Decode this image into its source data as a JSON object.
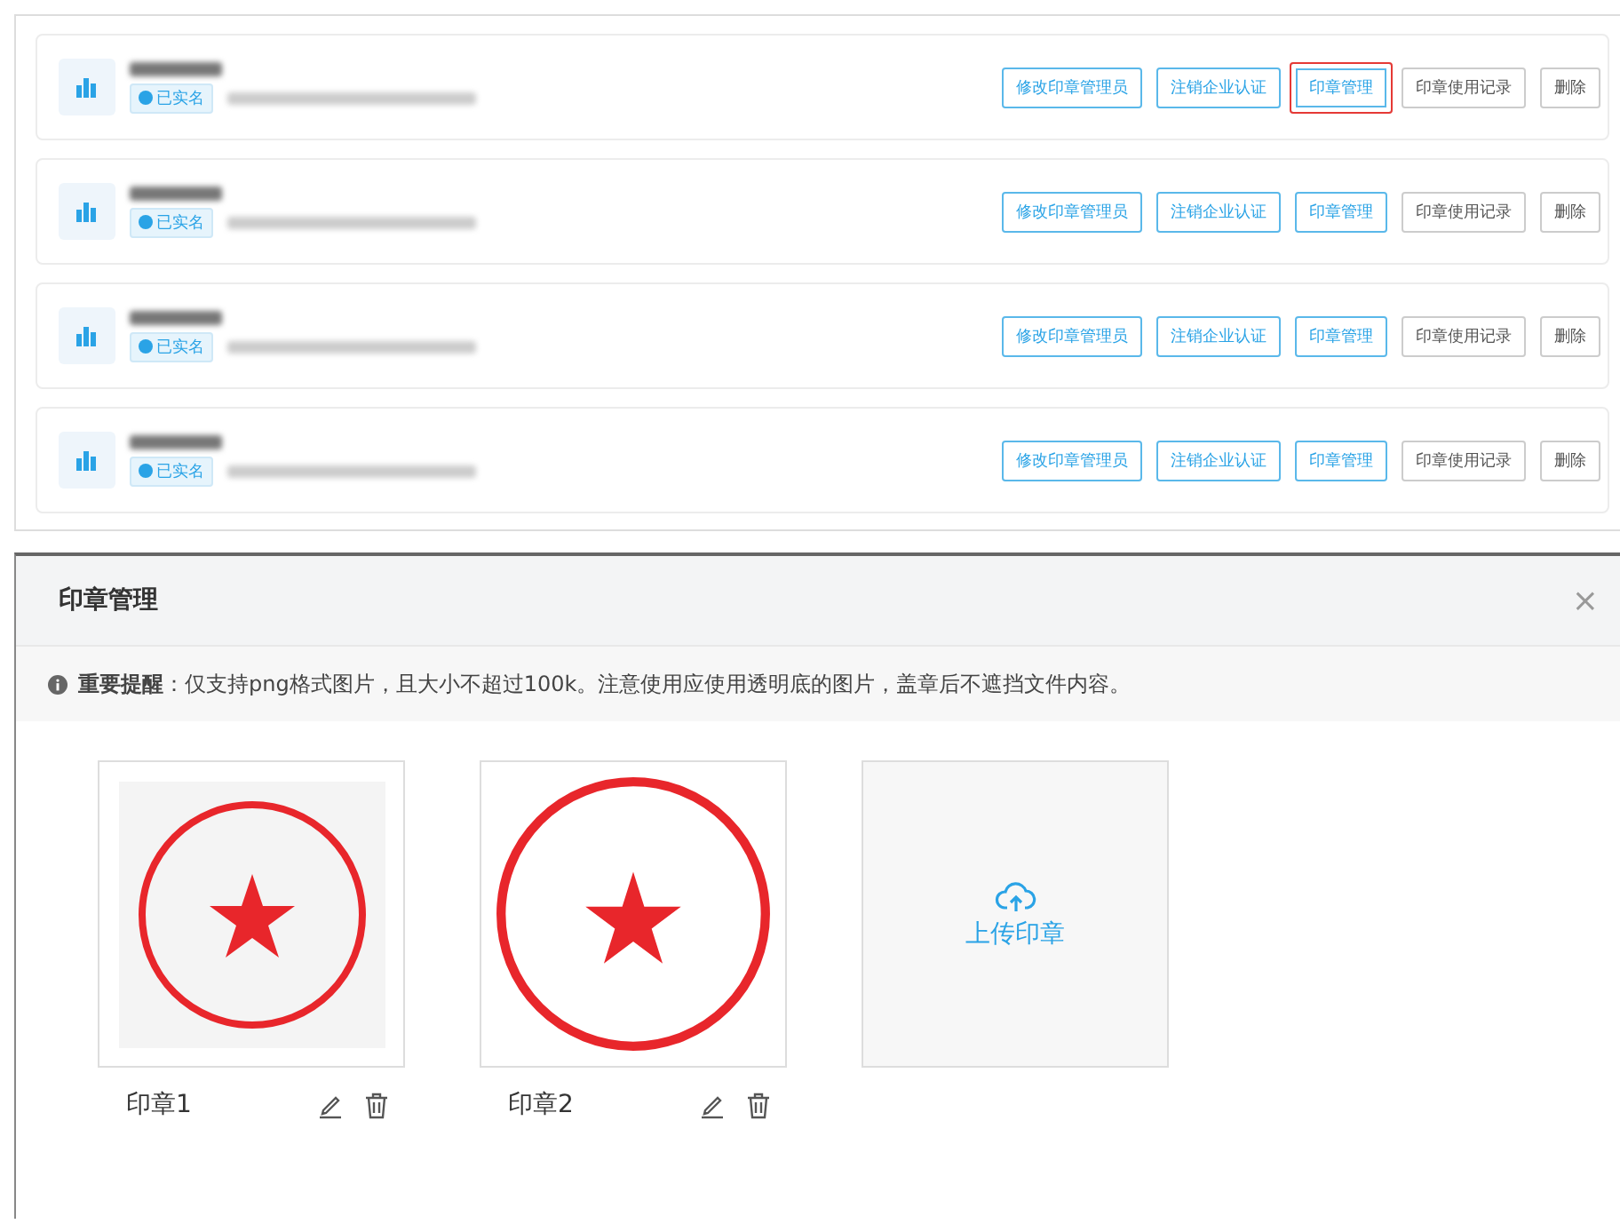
{
  "companies": [
    {
      "verified_badge": "已实名",
      "buttons": [
        {
          "label": "修改印章管理员",
          "kind": "primary",
          "highlighted": false
        },
        {
          "label": "注销企业认证",
          "kind": "primary",
          "highlighted": false
        },
        {
          "label": "印章管理",
          "kind": "primary",
          "highlighted": true
        },
        {
          "label": "印章使用记录",
          "kind": "default",
          "highlighted": false
        },
        {
          "label": "删除",
          "kind": "default",
          "highlighted": false
        }
      ]
    },
    {
      "verified_badge": "已实名",
      "buttons": [
        {
          "label": "修改印章管理员",
          "kind": "primary",
          "highlighted": false
        },
        {
          "label": "注销企业认证",
          "kind": "primary",
          "highlighted": false
        },
        {
          "label": "印章管理",
          "kind": "primary",
          "highlighted": false
        },
        {
          "label": "印章使用记录",
          "kind": "default",
          "highlighted": false
        },
        {
          "label": "删除",
          "kind": "default",
          "highlighted": false
        }
      ]
    },
    {
      "verified_badge": "已实名",
      "buttons": [
        {
          "label": "修改印章管理员",
          "kind": "primary",
          "highlighted": false
        },
        {
          "label": "注销企业认证",
          "kind": "primary",
          "highlighted": false
        },
        {
          "label": "印章管理",
          "kind": "primary",
          "highlighted": false
        },
        {
          "label": "印章使用记录",
          "kind": "default",
          "highlighted": false
        },
        {
          "label": "删除",
          "kind": "default",
          "highlighted": false
        }
      ]
    },
    {
      "verified_badge": "已实名",
      "buttons": [
        {
          "label": "修改印章管理员",
          "kind": "primary",
          "highlighted": false
        },
        {
          "label": "注销企业认证",
          "kind": "primary",
          "highlighted": false
        },
        {
          "label": "印章管理",
          "kind": "primary",
          "highlighted": false
        },
        {
          "label": "印章使用记录",
          "kind": "default",
          "highlighted": false
        },
        {
          "label": "删除",
          "kind": "default",
          "highlighted": false
        }
      ]
    }
  ],
  "dialog": {
    "title": "印章管理",
    "close": "×",
    "notice": "**重要提醒**：仅支持png格式图片，且大小不超过100k。注意使用应使用透明底的图片，盖章后不遮挡文件内容。",
    "seals": [
      {
        "name": "印章1",
        "kind": "textured"
      },
      {
        "name": "印章2",
        "kind": "solid"
      }
    ],
    "upload": {
      "label": "上传印章"
    }
  }
}
